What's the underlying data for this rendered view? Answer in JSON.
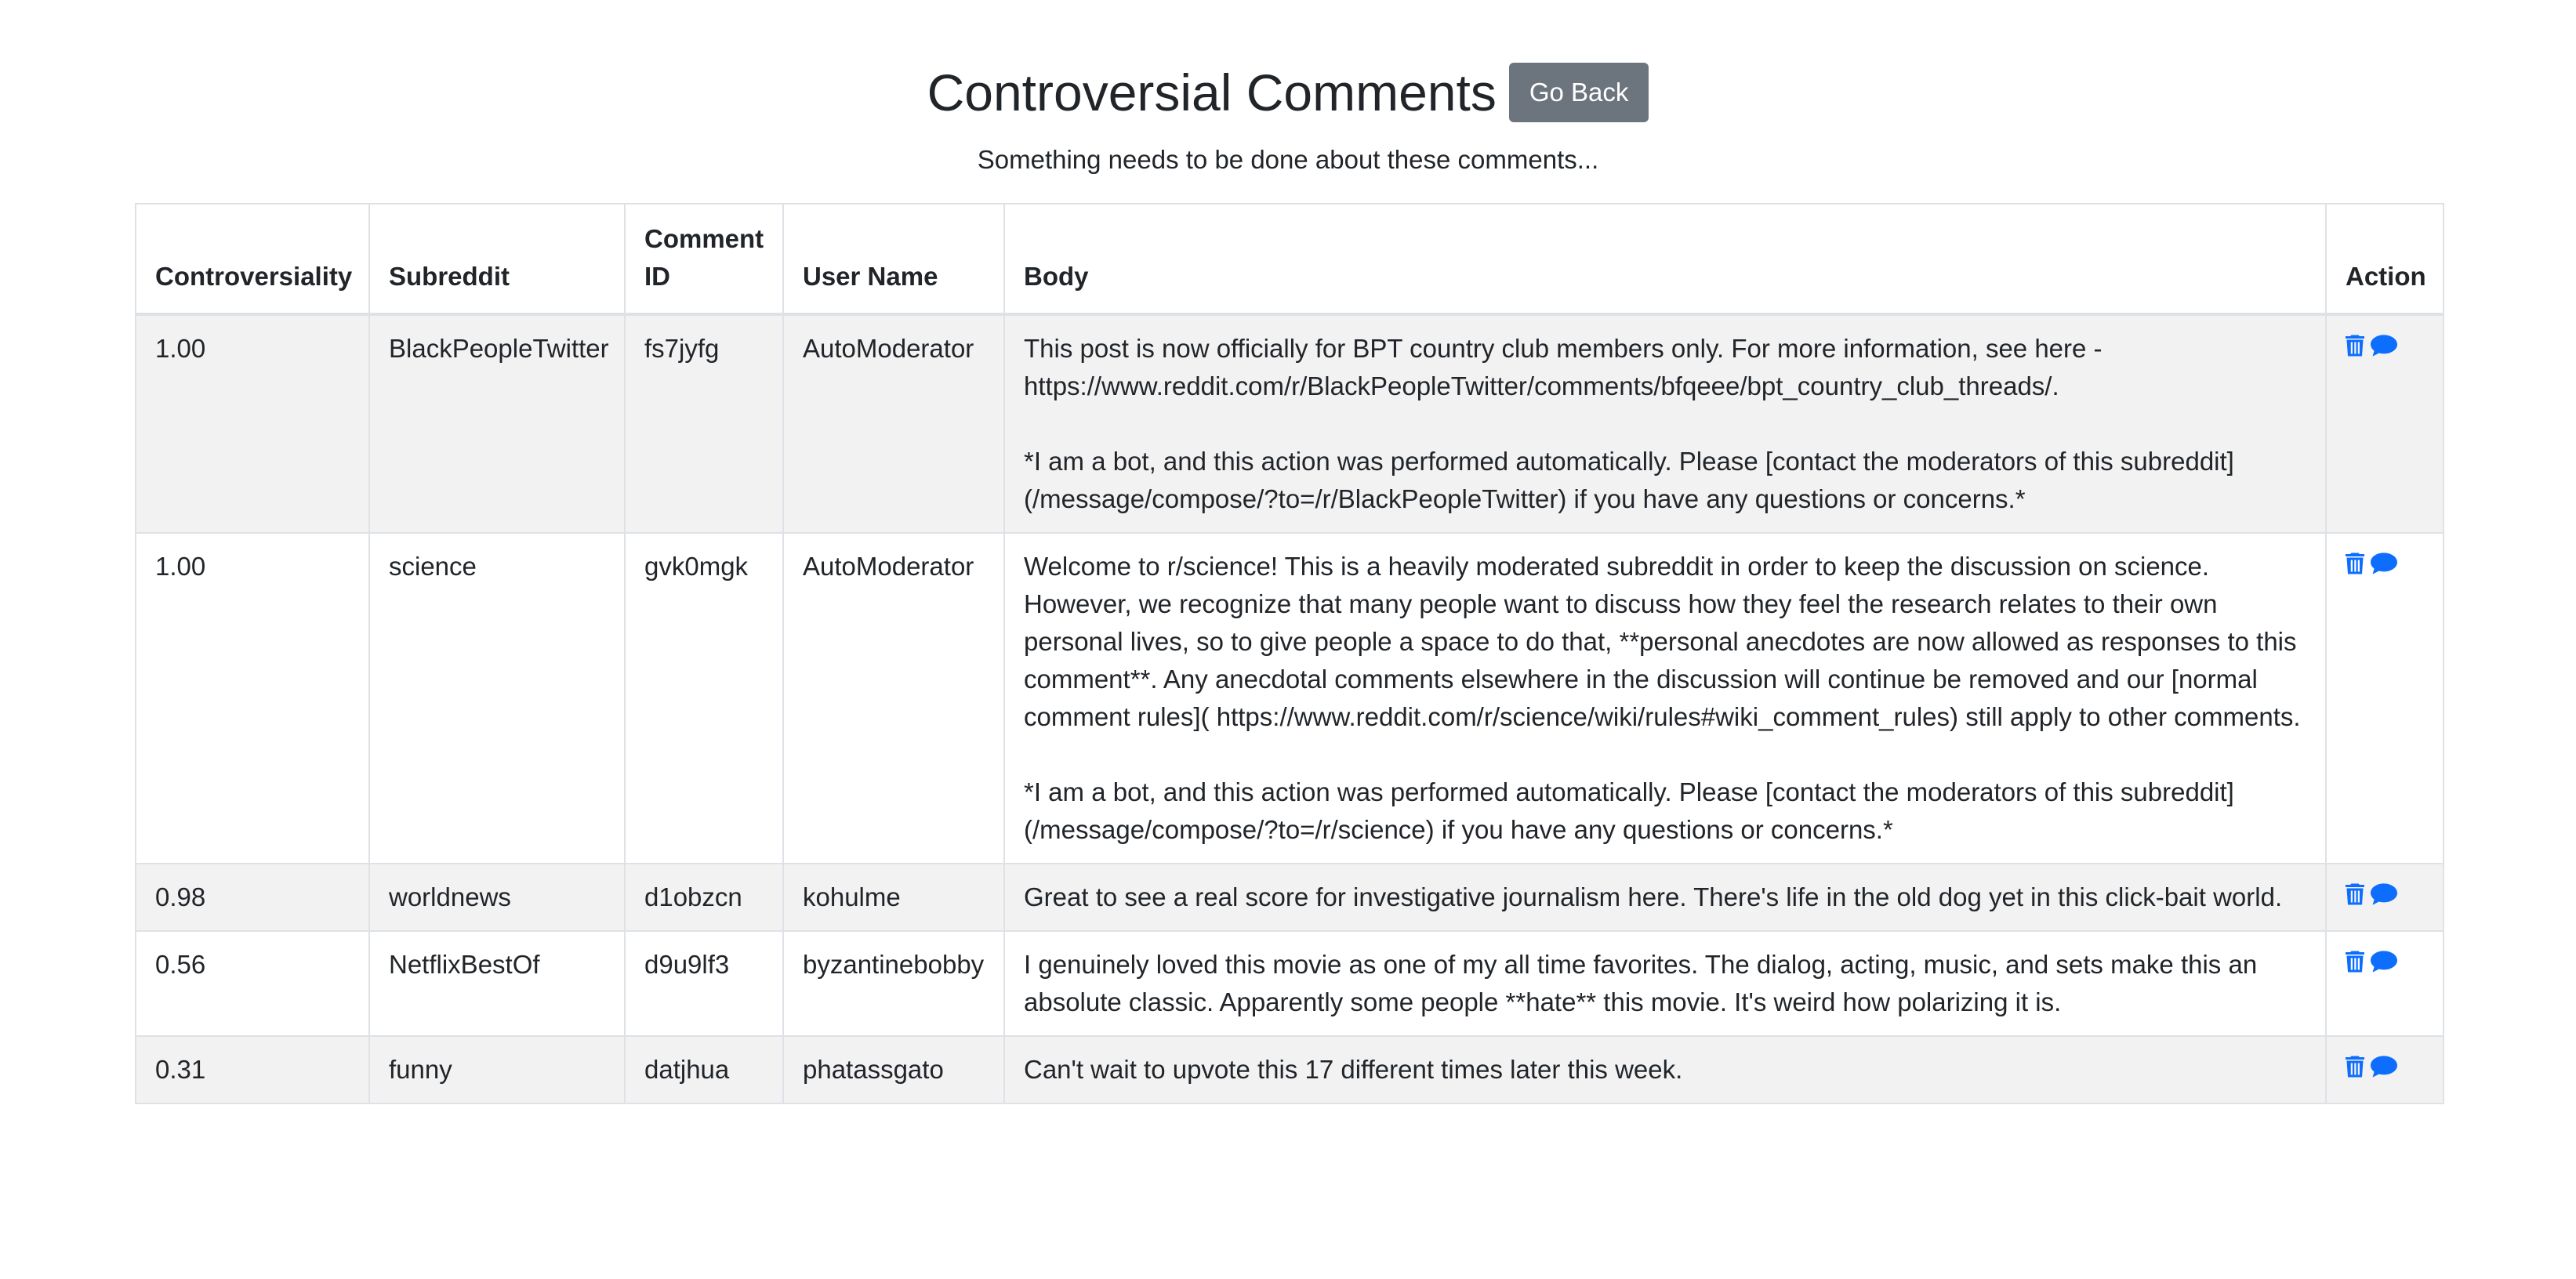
{
  "page": {
    "title": "Controversial Comments",
    "go_back_label": "Go Back",
    "subtitle": "Something needs to be done about these comments..."
  },
  "table": {
    "headers": [
      "Controversiality",
      "Subreddit",
      "Comment ID",
      "User Name",
      "Body",
      "Action"
    ],
    "rows": [
      {
        "controversiality": "1.00",
        "subreddit": "BlackPeopleTwitter",
        "comment_id": "fs7jyfg",
        "user_name": "AutoModerator",
        "body": "This post is now officially for BPT country club members only. For more information, see here - https://www.reddit.com/r/BlackPeopleTwitter/comments/bfqeee/bpt_country_club_threads/.\n\n*I am a bot, and this action was performed automatically. Please [contact the moderators of this subreddit](/message/compose/?to=/r/BlackPeopleTwitter) if you have any questions or concerns.*"
      },
      {
        "controversiality": "1.00",
        "subreddit": "science",
        "comment_id": "gvk0mgk",
        "user_name": "AutoModerator",
        "body": "Welcome to r/science! This is a heavily moderated subreddit in order to keep the discussion on science. However, we recognize that many people want to discuss how they feel the research relates to their own personal lives, so to give people a space to do that, **personal anecdotes are now allowed as responses to this comment**. Any anecdotal comments elsewhere in the discussion will continue be removed and our [normal comment rules]( https://www.reddit.com/r/science/wiki/rules#wiki_comment_rules) still apply to other comments.\n\n*I am a bot, and this action was performed automatically. Please [contact the moderators of this subreddit](/message/compose/?to=/r/science) if you have any questions or concerns.*"
      },
      {
        "controversiality": "0.98",
        "subreddit": "worldnews",
        "comment_id": "d1obzcn",
        "user_name": "kohulme",
        "body": "Great to see a real score for investigative journalism here. There's life in the old dog yet in this click-bait world."
      },
      {
        "controversiality": "0.56",
        "subreddit": "NetflixBestOf",
        "comment_id": "d9u9lf3",
        "user_name": "byzantinebobby",
        "body": "I genuinely loved this movie as one of my all time favorites. The dialog, acting, music, and sets make this an absolute classic. Apparently some people **hate** this movie. It's weird how polarizing it is."
      },
      {
        "controversiality": "0.31",
        "subreddit": "funny",
        "comment_id": "datjhua",
        "user_name": "phatassgato",
        "body": "Can't wait to upvote this 17 different times later this week."
      }
    ],
    "action_icons": [
      "trash-icon",
      "comment-icon"
    ]
  },
  "colors": {
    "button_secondary": "#6c757d",
    "icon_primary": "#0d6efd",
    "stripe": "#f2f2f2",
    "border": "#dee2e6",
    "text": "#212529"
  }
}
